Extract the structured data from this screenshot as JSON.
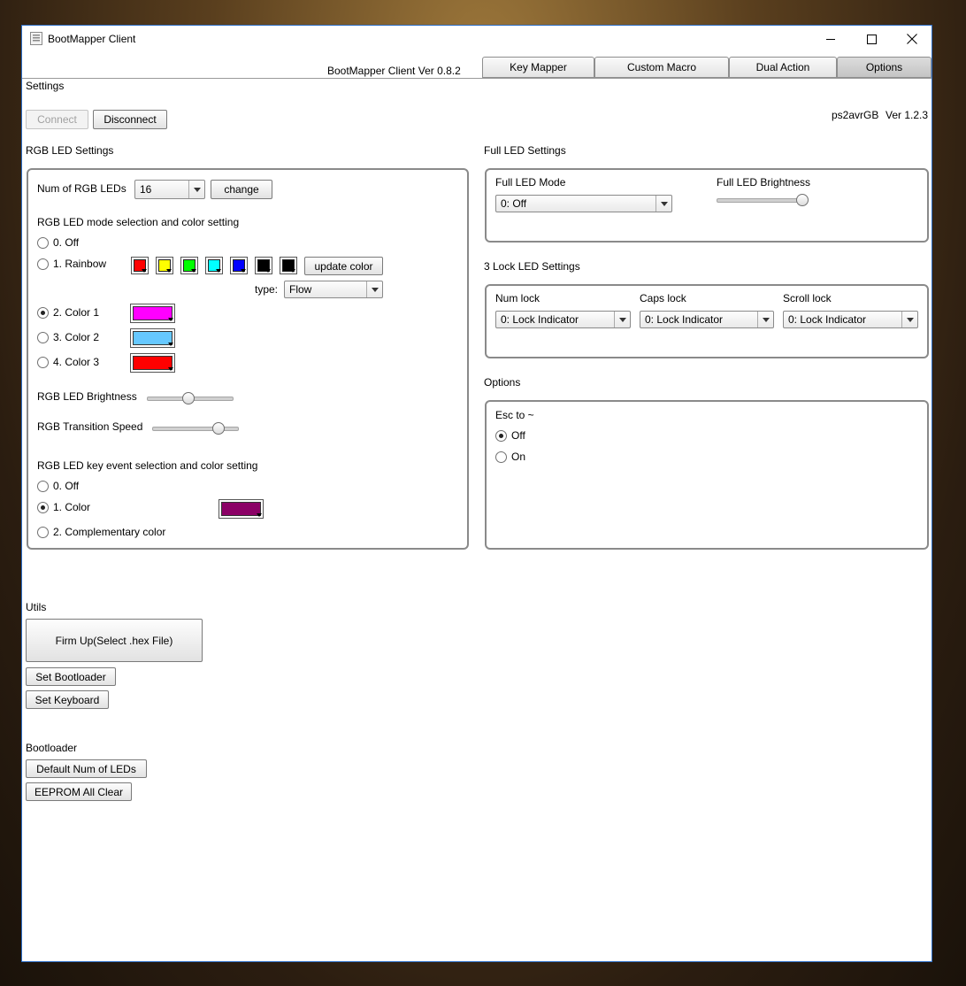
{
  "window": {
    "title": "BootMapper Client"
  },
  "header": {
    "version": "BootMapper Client Ver 0.8.2"
  },
  "tabs": [
    {
      "label": "Key Mapper"
    },
    {
      "label": "Custom Macro"
    },
    {
      "label": "Dual Action"
    },
    {
      "label": "Options"
    }
  ],
  "settings": {
    "heading": "Settings",
    "connect_label": "Connect",
    "disconnect_label": "Disconnect",
    "device_name": "ps2avrGB",
    "device_version": "Ver 1.2.3"
  },
  "rgb": {
    "heading": "RGB LED Settings",
    "num_label": "Num of RGB LEDs",
    "num_value": "16",
    "change_label": "change",
    "mode_heading": "RGB LED mode selection and color setting",
    "modes": [
      "0. Off",
      "1. Rainbow",
      "2. Color 1",
      "3. Color 2",
      "4. Color 3"
    ],
    "selected_mode": "2. Color 1",
    "rainbow_colors": [
      "#ff0000",
      "#ffff00",
      "#00ff00",
      "#00ffff",
      "#0000ff",
      "#000000",
      "#000000"
    ],
    "update_color_label": "update color",
    "type_label": "type:",
    "type_value": "Flow",
    "color1": "#ff00ff",
    "color2": "#66c8ff",
    "color3": "#ff0000",
    "brightness_label": "RGB LED Brightness",
    "brightness_value": 0.47,
    "speed_label": "RGB Transition Speed",
    "speed_value": 0.76,
    "key_event_heading": "RGB LED key event selection and color setting",
    "key_event_modes": [
      "0. Off",
      "1. Color",
      "2. Complementary color"
    ],
    "selected_key_event": "1. Color",
    "key_event_color": "#8b0066"
  },
  "full_led": {
    "heading": "Full LED Settings",
    "mode_label": "Full LED Mode",
    "mode_value": "0: Off",
    "brightness_label": "Full LED Brightness",
    "brightness_value": 0.98
  },
  "lock_led": {
    "heading": "3 Lock LED Settings",
    "num_label": "Num lock",
    "num_value": "0: Lock Indicator",
    "caps_label": "Caps lock",
    "caps_value": "0: Lock Indicator",
    "scroll_label": "Scroll lock",
    "scroll_value": "0: Lock Indicator"
  },
  "options": {
    "heading": "Options",
    "esc_label": "Esc to ~",
    "choices": [
      "Off",
      "On"
    ],
    "selected": "Off"
  },
  "utils": {
    "heading": "Utils",
    "firmup_label": "Firm Up(Select .hex File)",
    "set_bootloader_label": "Set Bootloader",
    "set_keyboard_label": "Set Keyboard"
  },
  "bootloader": {
    "heading": "Bootloader",
    "default_leds_label": "Default Num of LEDs",
    "eeprom_clear_label": "EEPROM All Clear"
  }
}
